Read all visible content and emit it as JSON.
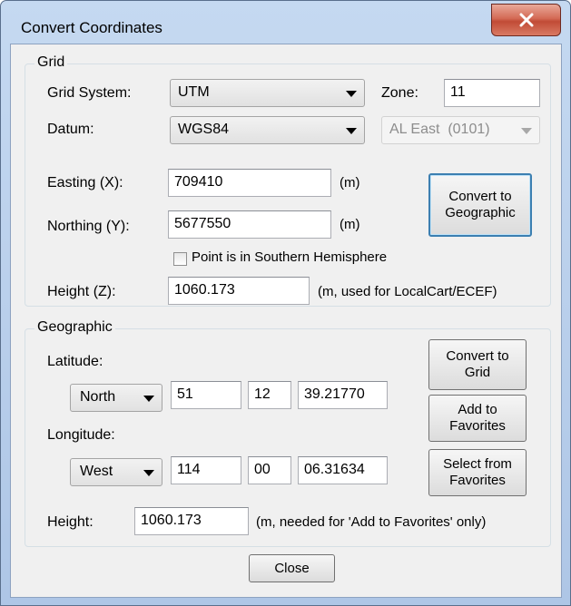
{
  "window": {
    "title": "Convert Coordinates"
  },
  "grid": {
    "group_title": "Grid",
    "grid_system_label": "Grid System:",
    "grid_system_value": "UTM",
    "zone_label": "Zone:",
    "zone_value": "11",
    "datum_label": "Datum:",
    "datum_value": "WGS84",
    "state_plane_value": "AL East  (0101)",
    "easting_label": "Easting (X):",
    "easting_value": "709410",
    "easting_unit": "(m)",
    "northing_label": "Northing (Y):",
    "northing_value": "5677550",
    "northing_unit": "(m)",
    "southern_hemisphere_label": "Point is in Southern Hemisphere",
    "southern_hemisphere_checked": false,
    "height_label": "Height (Z):",
    "height_value": "1060.173",
    "height_unit": "(m, used for LocalCart/ECEF)",
    "convert_line1": "Convert to",
    "convert_line2": "Geographic"
  },
  "geographic": {
    "group_title": "Geographic",
    "latitude_label": "Latitude:",
    "latitude_hemisphere": "North",
    "latitude_deg": "51",
    "latitude_min": "12",
    "latitude_sec": "39.21770",
    "longitude_label": "Longitude:",
    "longitude_hemisphere": "West",
    "longitude_deg": "114",
    "longitude_min": "00",
    "longitude_sec": "06.31634",
    "height_label": "Height:",
    "height_value": "1060.173",
    "height_note": "(m, needed for 'Add to Favorites' only)",
    "convert_line1": "Convert to",
    "convert_line2": "Grid",
    "add_fav_line1": "Add to",
    "add_fav_line2": "Favorites",
    "select_fav_line1": "Select from",
    "select_fav_line2": "Favorites"
  },
  "footer": {
    "close_label": "Close"
  },
  "icons": {
    "close": "close-icon",
    "dropdown": "chevron-down-icon",
    "checkbox": "checkbox-icon"
  },
  "colors": {
    "titlebar": "#c5d9f1",
    "close_button": "#c14b36",
    "default_button_border": "#3c7fb1",
    "dialog_bg": "#f0f0f0"
  }
}
